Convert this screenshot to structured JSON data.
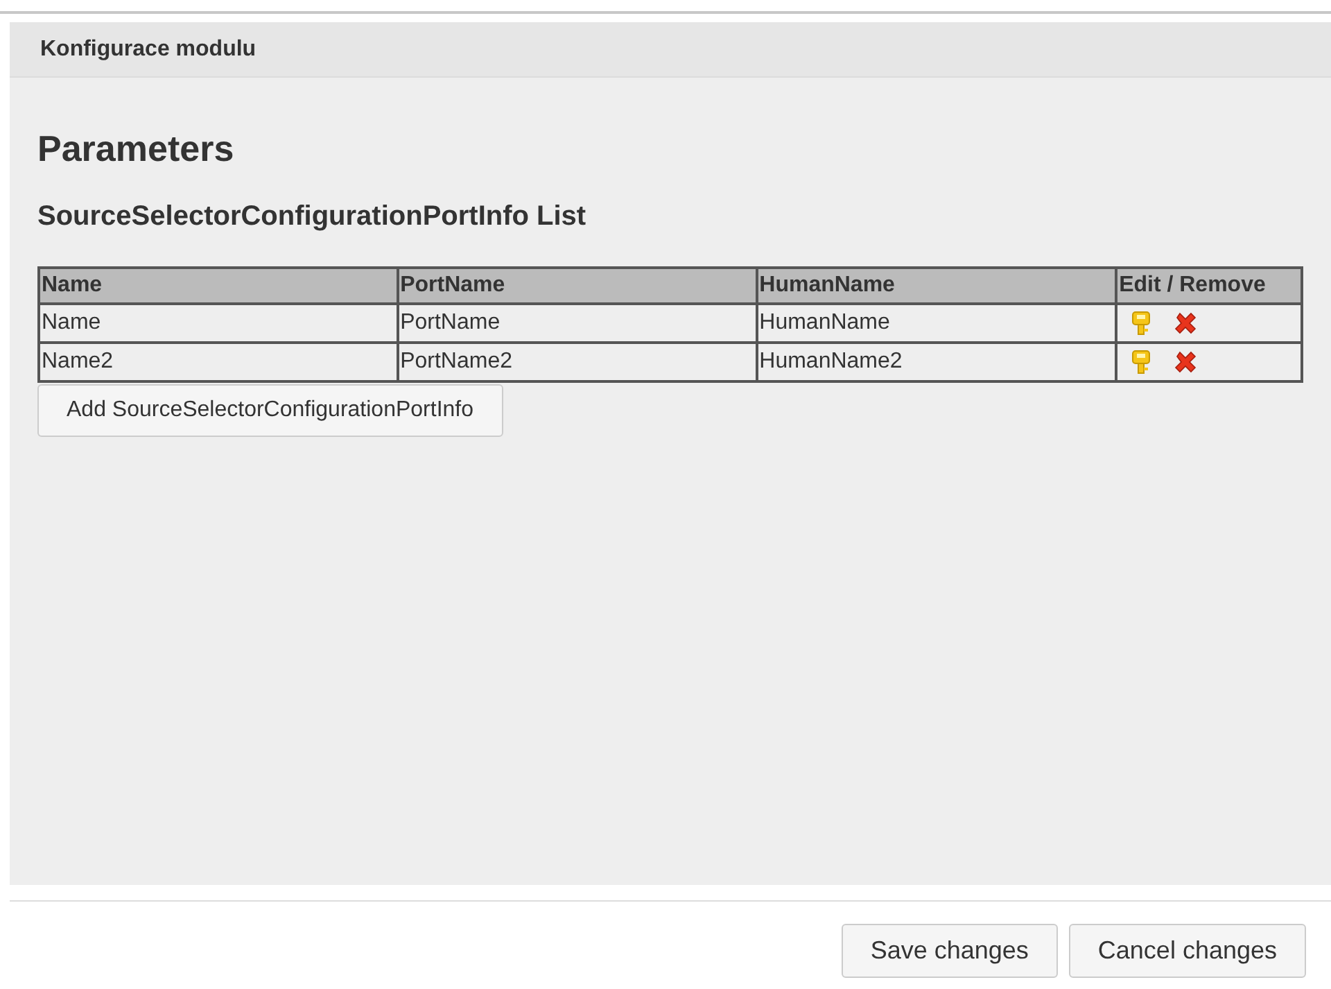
{
  "panel": {
    "title": "Konfigurace modulu"
  },
  "heading": "Parameters",
  "list_title": "SourceSelectorConfigurationPortInfo List",
  "table": {
    "columns": [
      "Name",
      "PortName",
      "HumanName",
      "Edit / Remove"
    ],
    "rows": [
      {
        "cells": [
          "Name",
          "PortName",
          "HumanName"
        ]
      },
      {
        "cells": [
          "Name2",
          "PortName2",
          "HumanName2"
        ]
      }
    ]
  },
  "add_button": "Add SourceSelectorConfigurationPortInfo",
  "buttons": [
    "Save changes",
    "Cancel changes"
  ]
}
